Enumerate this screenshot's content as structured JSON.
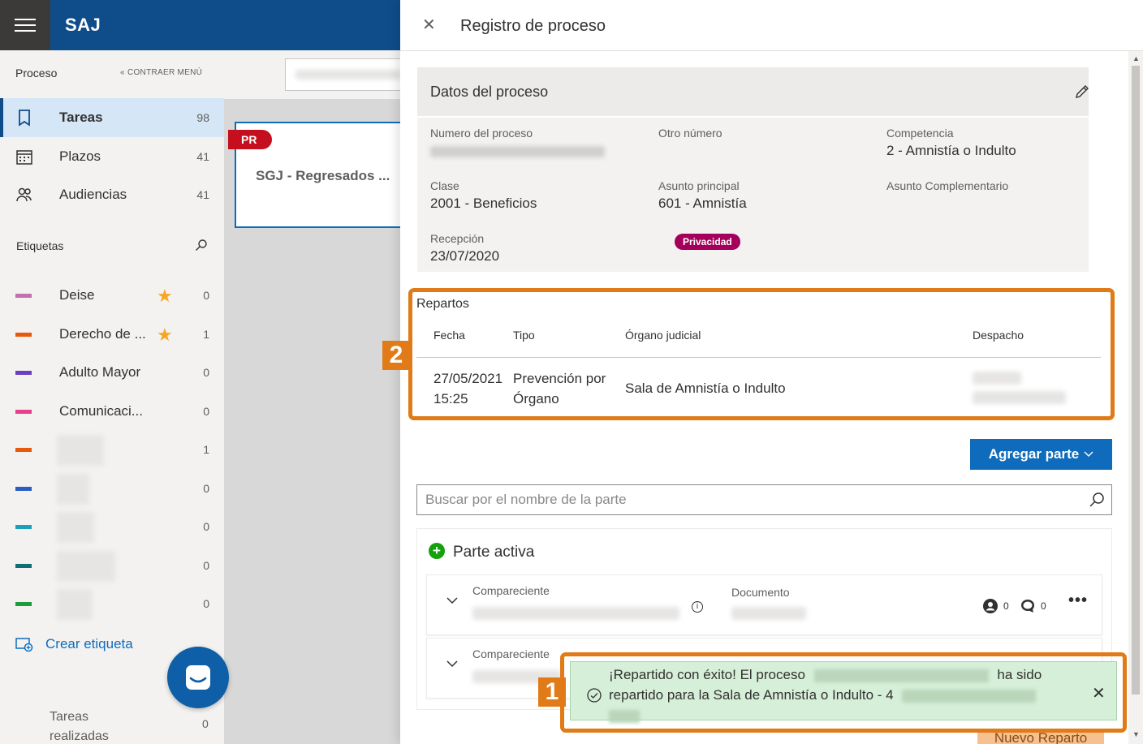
{
  "app": {
    "brand": "SAJ"
  },
  "sidebar": {
    "heading": "Proceso",
    "collapse_label": "CONTRAER MENÚ",
    "nav": [
      {
        "label": "Tareas",
        "count": "98",
        "icon": "tasks-icon",
        "active": true
      },
      {
        "label": "Plazos",
        "count": "41",
        "icon": "calendar-icon",
        "active": false
      },
      {
        "label": "Audiencias",
        "count": "41",
        "icon": "people-icon",
        "active": false
      }
    ],
    "tags_heading": "Etiquetas",
    "tags": [
      {
        "label": "Deise",
        "count": "0",
        "color": "#c36fb0",
        "starred": true
      },
      {
        "label": "Derecho de ...",
        "count": "1",
        "color": "#e8590c",
        "starred": true
      },
      {
        "label": "Adulto Mayor",
        "count": "0",
        "color": "#6b3fc1",
        "starred": false
      },
      {
        "label": "Comunicaci...",
        "count": "0",
        "color": "#e83e8c",
        "starred": false
      },
      {
        "label": "",
        "count": "1",
        "color": "#e8590c",
        "starred": false
      },
      {
        "label": "",
        "count": "0",
        "color": "#2b5cc4",
        "starred": false
      },
      {
        "label": "",
        "count": "0",
        "color": "#17a2b8",
        "starred": false
      },
      {
        "label": "",
        "count": "0",
        "color": "#0e6f75",
        "starred": false
      },
      {
        "label": "",
        "count": "0",
        "color": "#1e9b3a",
        "starred": false
      }
    ],
    "create_tag": "Crear etiqueta",
    "done_label": "Tareas realizadas",
    "done_count": "0"
  },
  "card": {
    "badge": "PR",
    "title": "SGJ - Regresados ..."
  },
  "panel": {
    "title": "Registro de proceso",
    "datos": {
      "title": "Datos del proceso",
      "numero_label": "Numero del proceso",
      "otro_label": "Otro número",
      "competencia_label": "Competencia",
      "competencia_value": "2 - Amnistía o Indulto",
      "clase_label": "Clase",
      "clase_value": "2001 - Beneficios",
      "asunto_label": "Asunto principal",
      "asunto_value": "601 - Amnistía",
      "asunto_comp_label": "Asunto Complementario",
      "recepcion_label": "Recepción",
      "recepcion_value": "23/07/2020",
      "privacidad": "Privacidad"
    },
    "repartos": {
      "title": "Repartos",
      "headers": [
        "Fecha",
        "Tipo",
        "Órgano judicial",
        "Despacho"
      ],
      "row": {
        "fecha_1": "27/05/2021",
        "fecha_2": "15:25",
        "tipo_1": "Prevención por",
        "tipo_2": "Órgano",
        "organo": "Sala de Amnistía o Indulto"
      }
    },
    "add_part": "Agregar parte",
    "search_placeholder": "Buscar por el nombre de la parte",
    "parte_activa": "Parte activa",
    "party_label": "Compareciente",
    "doc_label": "Documento",
    "people_count": "0",
    "comment_count": "0",
    "nuevo_reparto": "Nuevo Reparto"
  },
  "callouts": [
    "1",
    "2"
  ],
  "toast": {
    "line1_a": "¡Repartido con éxito! El proceso",
    "line1_b": "ha sido",
    "line2": "repartido para la Sala de Amnistía o Indulto - 4"
  },
  "colors": {
    "brand": "#0f4c8a",
    "accent": "#0f6cbd",
    "highlight": "#e07b17",
    "success_bg": "#d6efd8",
    "privacy": "#a4005b"
  }
}
